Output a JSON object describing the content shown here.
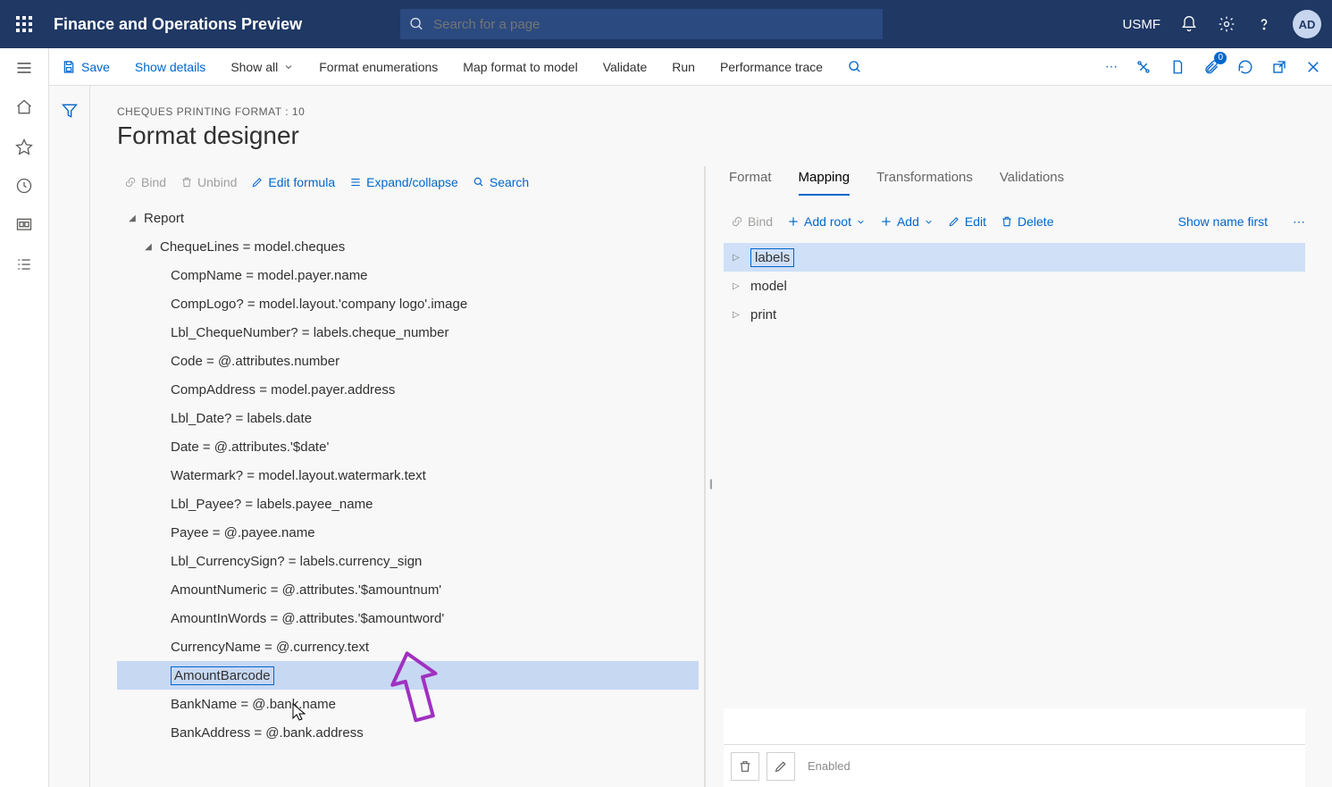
{
  "header": {
    "brand": "Finance and Operations Preview",
    "search_placeholder": "Search for a page",
    "entity": "USMF",
    "avatar": "AD"
  },
  "commandbar": {
    "save": "Save",
    "show_details": "Show details",
    "show_all": "Show all",
    "format_enum": "Format enumerations",
    "map_format": "Map format to model",
    "validate": "Validate",
    "run": "Run",
    "perf_trace": "Performance trace",
    "badge": "0"
  },
  "page": {
    "breadcrumb": "CHEQUES PRINTING FORMAT : 10",
    "title": "Format designer"
  },
  "left_toolbar": {
    "bind": "Bind",
    "unbind": "Unbind",
    "edit_formula": "Edit formula",
    "expand_collapse": "Expand/collapse",
    "search": "Search"
  },
  "tree": {
    "root": "Report",
    "cheque_lines": "ChequeLines = model.cheques",
    "items": [
      "CompName = model.payer.name",
      "CompLogo? = model.layout.'company logo'.image",
      "Lbl_ChequeNumber? = labels.cheque_number",
      "Code = @.attributes.number",
      "CompAddress = model.payer.address",
      "Lbl_Date? = labels.date",
      "Date = @.attributes.'$date'",
      "Watermark? = model.layout.watermark.text",
      "Lbl_Payee? = labels.payee_name",
      "Payee = @.payee.name",
      "Lbl_CurrencySign? = labels.currency_sign",
      "AmountNumeric = @.attributes.'$amountnum'",
      "AmountInWords = @.attributes.'$amountword'",
      "CurrencyName = @.currency.text",
      "AmountBarcode",
      "BankName = @.bank.name",
      "BankAddress = @.bank.address"
    ],
    "selected_index": 14
  },
  "right_tabs": [
    "Format",
    "Mapping",
    "Transformations",
    "Validations"
  ],
  "right_tab_active": 1,
  "right_toolbar": {
    "bind": "Bind",
    "add_root": "Add root",
    "add": "Add",
    "edit": "Edit",
    "delete": "Delete",
    "show_name": "Show name first"
  },
  "data_sources": [
    {
      "label": "labels",
      "selected": true
    },
    {
      "label": "model",
      "selected": false
    },
    {
      "label": "print",
      "selected": false
    }
  ],
  "editor_strip": {
    "enabled": "Enabled"
  }
}
